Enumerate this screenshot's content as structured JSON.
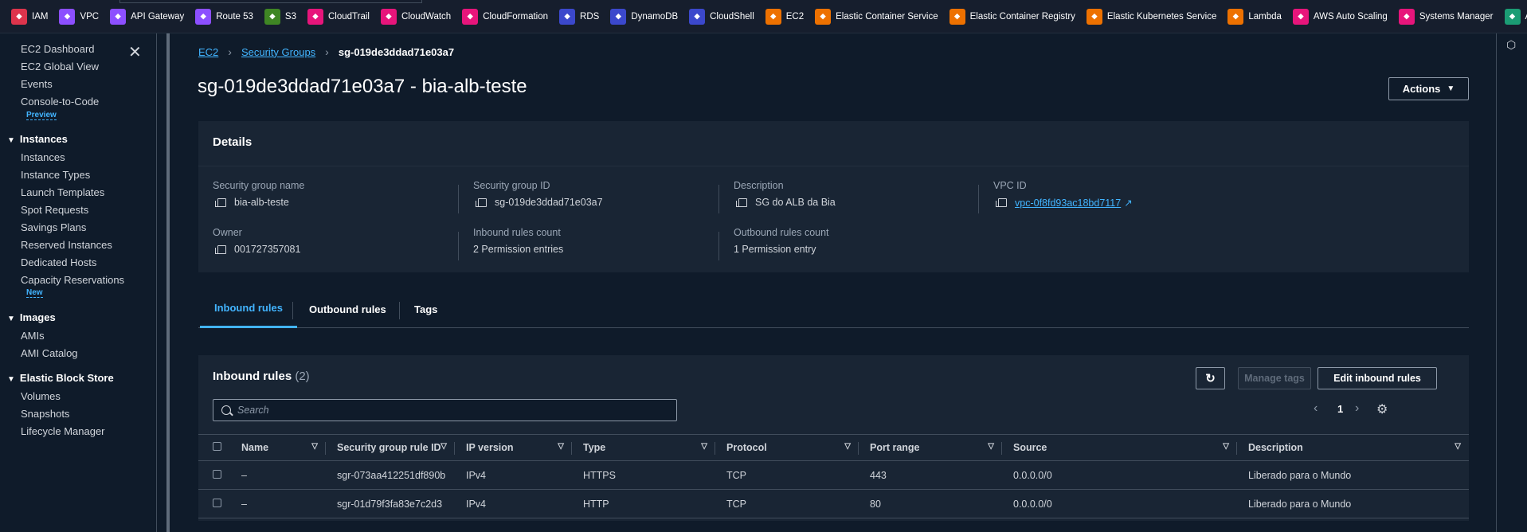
{
  "topbar": {
    "services": [
      {
        "label": "IAM",
        "color": "#dd344c",
        "icon": "iam-icon"
      },
      {
        "label": "VPC",
        "color": "#8c4fff",
        "icon": "vpc-icon"
      },
      {
        "label": "API Gateway",
        "color": "#8c4fff",
        "icon": "api-gateway-icon"
      },
      {
        "label": "Route 53",
        "color": "#8c4fff",
        "icon": "route53-icon"
      },
      {
        "label": "S3",
        "color": "#3f8624",
        "icon": "s3-icon"
      },
      {
        "label": "CloudTrail",
        "color": "#e7157b",
        "icon": "cloudtrail-icon"
      },
      {
        "label": "CloudWatch",
        "color": "#e7157b",
        "icon": "cloudwatch-icon"
      },
      {
        "label": "CloudFormation",
        "color": "#e7157b",
        "icon": "cloudformation-icon"
      },
      {
        "label": "RDS",
        "color": "#3b48cc",
        "icon": "rds-icon"
      },
      {
        "label": "DynamoDB",
        "color": "#3b48cc",
        "icon": "dynamodb-icon"
      },
      {
        "label": "CloudShell",
        "color": "#3b48cc",
        "icon": "cloudshell-icon"
      },
      {
        "label": "EC2",
        "color": "#ed7100",
        "icon": "ec2-icon"
      },
      {
        "label": "Elastic Container Service",
        "color": "#ed7100",
        "icon": "ecs-icon"
      },
      {
        "label": "Elastic Container Registry",
        "color": "#ed7100",
        "icon": "ecr-icon"
      },
      {
        "label": "Elastic Kubernetes Service",
        "color": "#ed7100",
        "icon": "eks-icon"
      },
      {
        "label": "Lambda",
        "color": "#ed7100",
        "icon": "lambda-icon"
      },
      {
        "label": "AWS Auto Scaling",
        "color": "#e7157b",
        "icon": "autoscaling-icon"
      },
      {
        "label": "Systems Manager",
        "color": "#e7157b",
        "icon": "systems-manager-icon"
      },
      {
        "label": "A",
        "color": "#1b9c74",
        "icon": "extra-service-icon"
      }
    ]
  },
  "sidebar": {
    "items": {
      "ec2_dashboard": "EC2 Dashboard",
      "ec2_global_view": "EC2 Global View",
      "events": "Events",
      "console_to_code": "Console-to-Code",
      "preview_badge": "Preview",
      "instances_section": "Instances",
      "instances": "Instances",
      "instance_types": "Instance Types",
      "launch_templates": "Launch Templates",
      "spot_requests": "Spot Requests",
      "savings_plans": "Savings Plans",
      "reserved_instances": "Reserved Instances",
      "dedicated_hosts": "Dedicated Hosts",
      "capacity_reservations": "Capacity Reservations",
      "new_badge": "New",
      "images_section": "Images",
      "amis": "AMIs",
      "ami_catalog": "AMI Catalog",
      "ebs_section": "Elastic Block Store",
      "volumes": "Volumes",
      "snapshots": "Snapshots",
      "lifecycle_manager": "Lifecycle Manager"
    }
  },
  "breadcrumb": {
    "ec2": "EC2",
    "security_groups": "Security Groups",
    "current": "sg-019de3ddad71e03a7"
  },
  "page": {
    "title": "sg-019de3ddad71e03a7 - bia-alb-teste",
    "actions_label": "Actions"
  },
  "details": {
    "header": "Details",
    "sg_name_label": "Security group name",
    "sg_name_value": "bia-alb-teste",
    "sg_id_label": "Security group ID",
    "sg_id_value": "sg-019de3ddad71e03a7",
    "description_label": "Description",
    "description_value": "SG do ALB da Bia",
    "vpc_id_label": "VPC ID",
    "vpc_id_value": "vpc-0f8fd93ac18bd7117",
    "owner_label": "Owner",
    "owner_value": "001727357081",
    "inbound_count_label": "Inbound rules count",
    "inbound_count_value": "2 Permission entries",
    "outbound_count_label": "Outbound rules count",
    "outbound_count_value": "1 Permission entry"
  },
  "tabs": {
    "inbound": "Inbound rules",
    "outbound": "Outbound rules",
    "tags": "Tags"
  },
  "rules": {
    "header": "Inbound rules",
    "count": "(2)",
    "manage_tags": "Manage tags",
    "edit_inbound": "Edit inbound rules",
    "search_placeholder": "Search",
    "page": "1",
    "columns": [
      "Name",
      "Security group rule ID",
      "IP version",
      "Type",
      "Protocol",
      "Port range",
      "Source",
      "Description"
    ],
    "rows": [
      [
        "–",
        "sgr-073aa412251df890b",
        "IPv4",
        "HTTPS",
        "TCP",
        "443",
        "0.0.0.0/0",
        "Liberado para o Mundo"
      ],
      [
        "–",
        "sgr-01d79f3fa83e7c2d3",
        "IPv4",
        "HTTP",
        "TCP",
        "80",
        "0.0.0.0/0",
        "Liberado para o Mundo"
      ]
    ]
  }
}
